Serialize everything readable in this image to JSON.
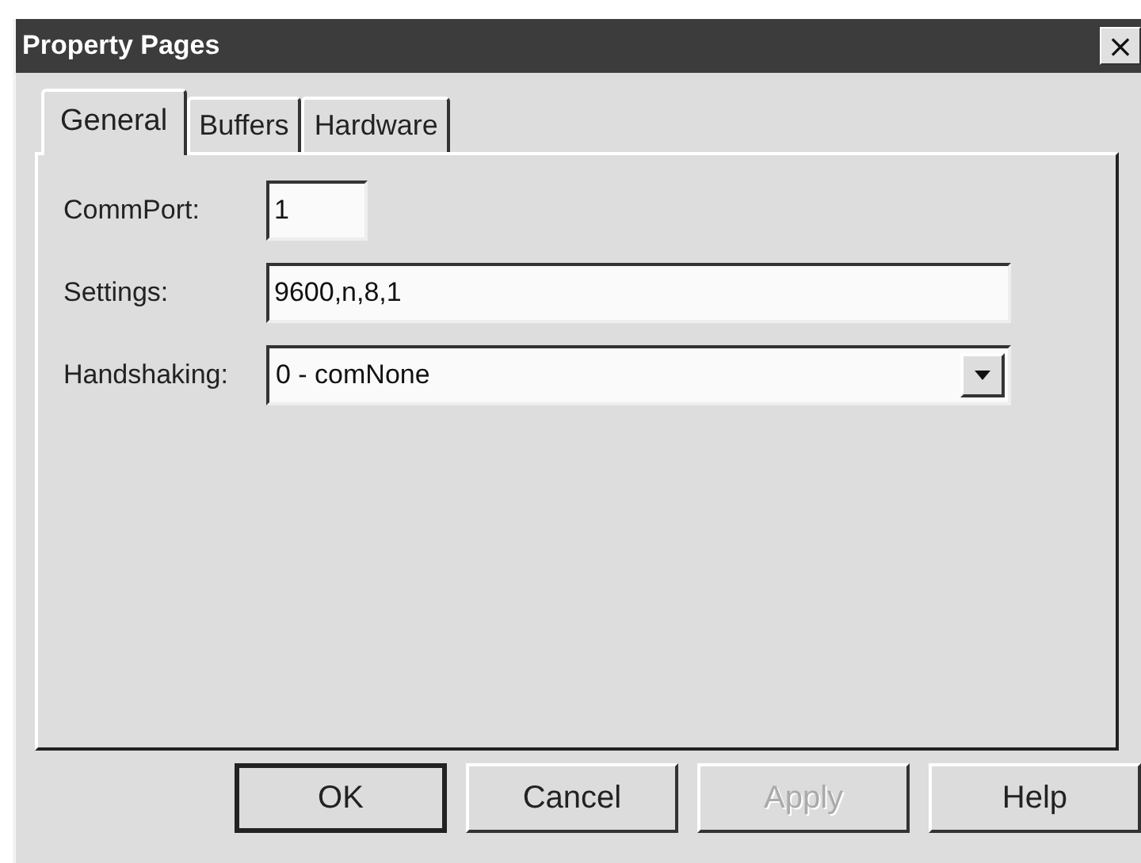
{
  "window": {
    "title": "Property Pages",
    "close_glyph": "×"
  },
  "tabs": [
    {
      "label": "General",
      "selected": true
    },
    {
      "label": "Buffers",
      "selected": false
    },
    {
      "label": "Hardware",
      "selected": false
    }
  ],
  "fields": [
    {
      "kind": "short_text",
      "label": "CommPort:",
      "value": "1"
    },
    {
      "kind": "text",
      "label": "Settings:",
      "value": "9600,n,8,1"
    },
    {
      "kind": "dropdown",
      "label": "Handshaking:",
      "value": "0 - comNone"
    }
  ],
  "buttons": [
    {
      "label": "OK",
      "default": true,
      "disabled": false
    },
    {
      "label": "Cancel",
      "default": false,
      "disabled": false
    },
    {
      "label": "Apply",
      "default": false,
      "disabled": true
    },
    {
      "label": "Help",
      "default": false,
      "disabled": false
    }
  ]
}
